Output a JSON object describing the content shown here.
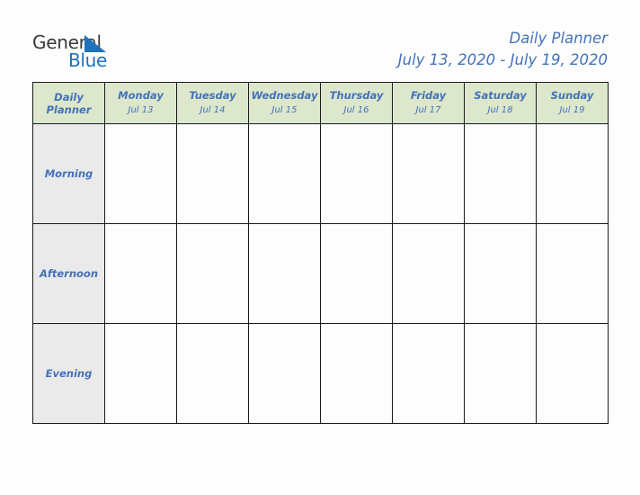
{
  "brand": {
    "name_part1": "General",
    "name_part2": "Blue",
    "triangle_color": "#1e72bb",
    "text_color_dark": "#3a3a3a",
    "text_color_blue": "#1e72bb"
  },
  "header": {
    "title": "Daily Planner",
    "date_range": "July 13, 2020 - July 19, 2020",
    "title_color": "#4472b8"
  },
  "table": {
    "corner": {
      "line1": "Daily",
      "line2": "Planner"
    },
    "header_bg": "#dce7cc",
    "label_bg": "#eaeaea",
    "border_color": "#1a1a1a",
    "columns": [
      {
        "day": "Monday",
        "date": "Jul 13"
      },
      {
        "day": "Tuesday",
        "date": "Jul 14"
      },
      {
        "day": "Wednesday",
        "date": "Jul 15"
      },
      {
        "day": "Thursday",
        "date": "Jul 16"
      },
      {
        "day": "Friday",
        "date": "Jul 17"
      },
      {
        "day": "Saturday",
        "date": "Jul 18"
      },
      {
        "day": "Sunday",
        "date": "Jul 19"
      }
    ],
    "rows": [
      {
        "label": "Morning",
        "cells": [
          "",
          "",
          "",
          "",
          "",
          "",
          ""
        ]
      },
      {
        "label": "Afternoon",
        "cells": [
          "",
          "",
          "",
          "",
          "",
          "",
          ""
        ]
      },
      {
        "label": "Evening",
        "cells": [
          "",
          "",
          "",
          "",
          "",
          "",
          ""
        ]
      }
    ]
  }
}
